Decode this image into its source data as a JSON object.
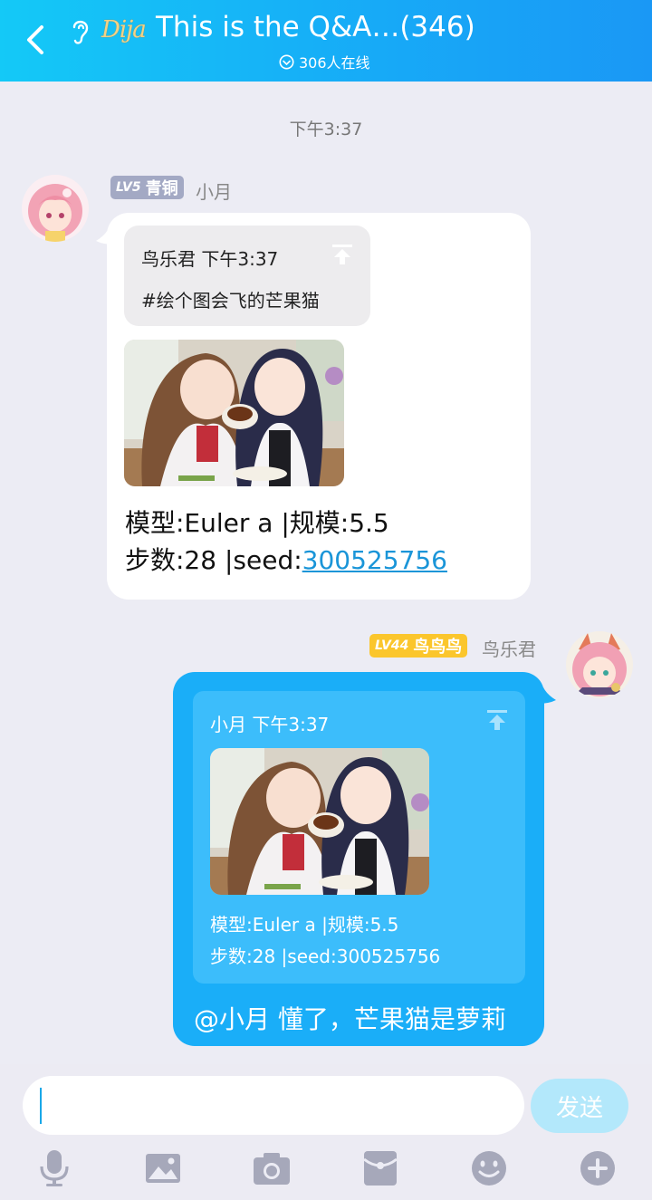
{
  "header": {
    "title": "This is the Q&A…(346)",
    "online": "306人在线",
    "logo_text": "Dija"
  },
  "time_divider": "下午3:37",
  "messages": [
    {
      "badge_level": "LV5",
      "badge_title": "青铜",
      "badge_color": "#a3a9c4",
      "sender": "小月",
      "quote": {
        "author": "鸟乐君",
        "time": "下午3:37",
        "text": "#绘个图会飞的芒果猫"
      },
      "line1": "模型:Euler a   |规模:5.5",
      "line2_prefix": "步数:28        |seed:",
      "seed": "300525756"
    },
    {
      "badge_level": "LV44",
      "badge_title": "鸟鸟鸟",
      "badge_color": "#fbc62c",
      "sender": "鸟乐君",
      "quote": {
        "author": "小月",
        "time": "下午3:37",
        "line1": "模型:Euler a   |规模:5.5",
        "line2": "步数:28        |seed:300525756"
      },
      "reply": "@小月 懂了，芒果猫是萝莉"
    }
  ],
  "input": {
    "placeholder": "",
    "send_label": "发送"
  },
  "colors": {
    "header": "#17a9f7",
    "bubble_self": "#1aaef8",
    "accent": "#1a95d8"
  },
  "toolbar_icons": [
    "microphone-icon",
    "image-icon",
    "camera-icon",
    "red-packet-icon",
    "emoji-icon",
    "plus-icon"
  ]
}
